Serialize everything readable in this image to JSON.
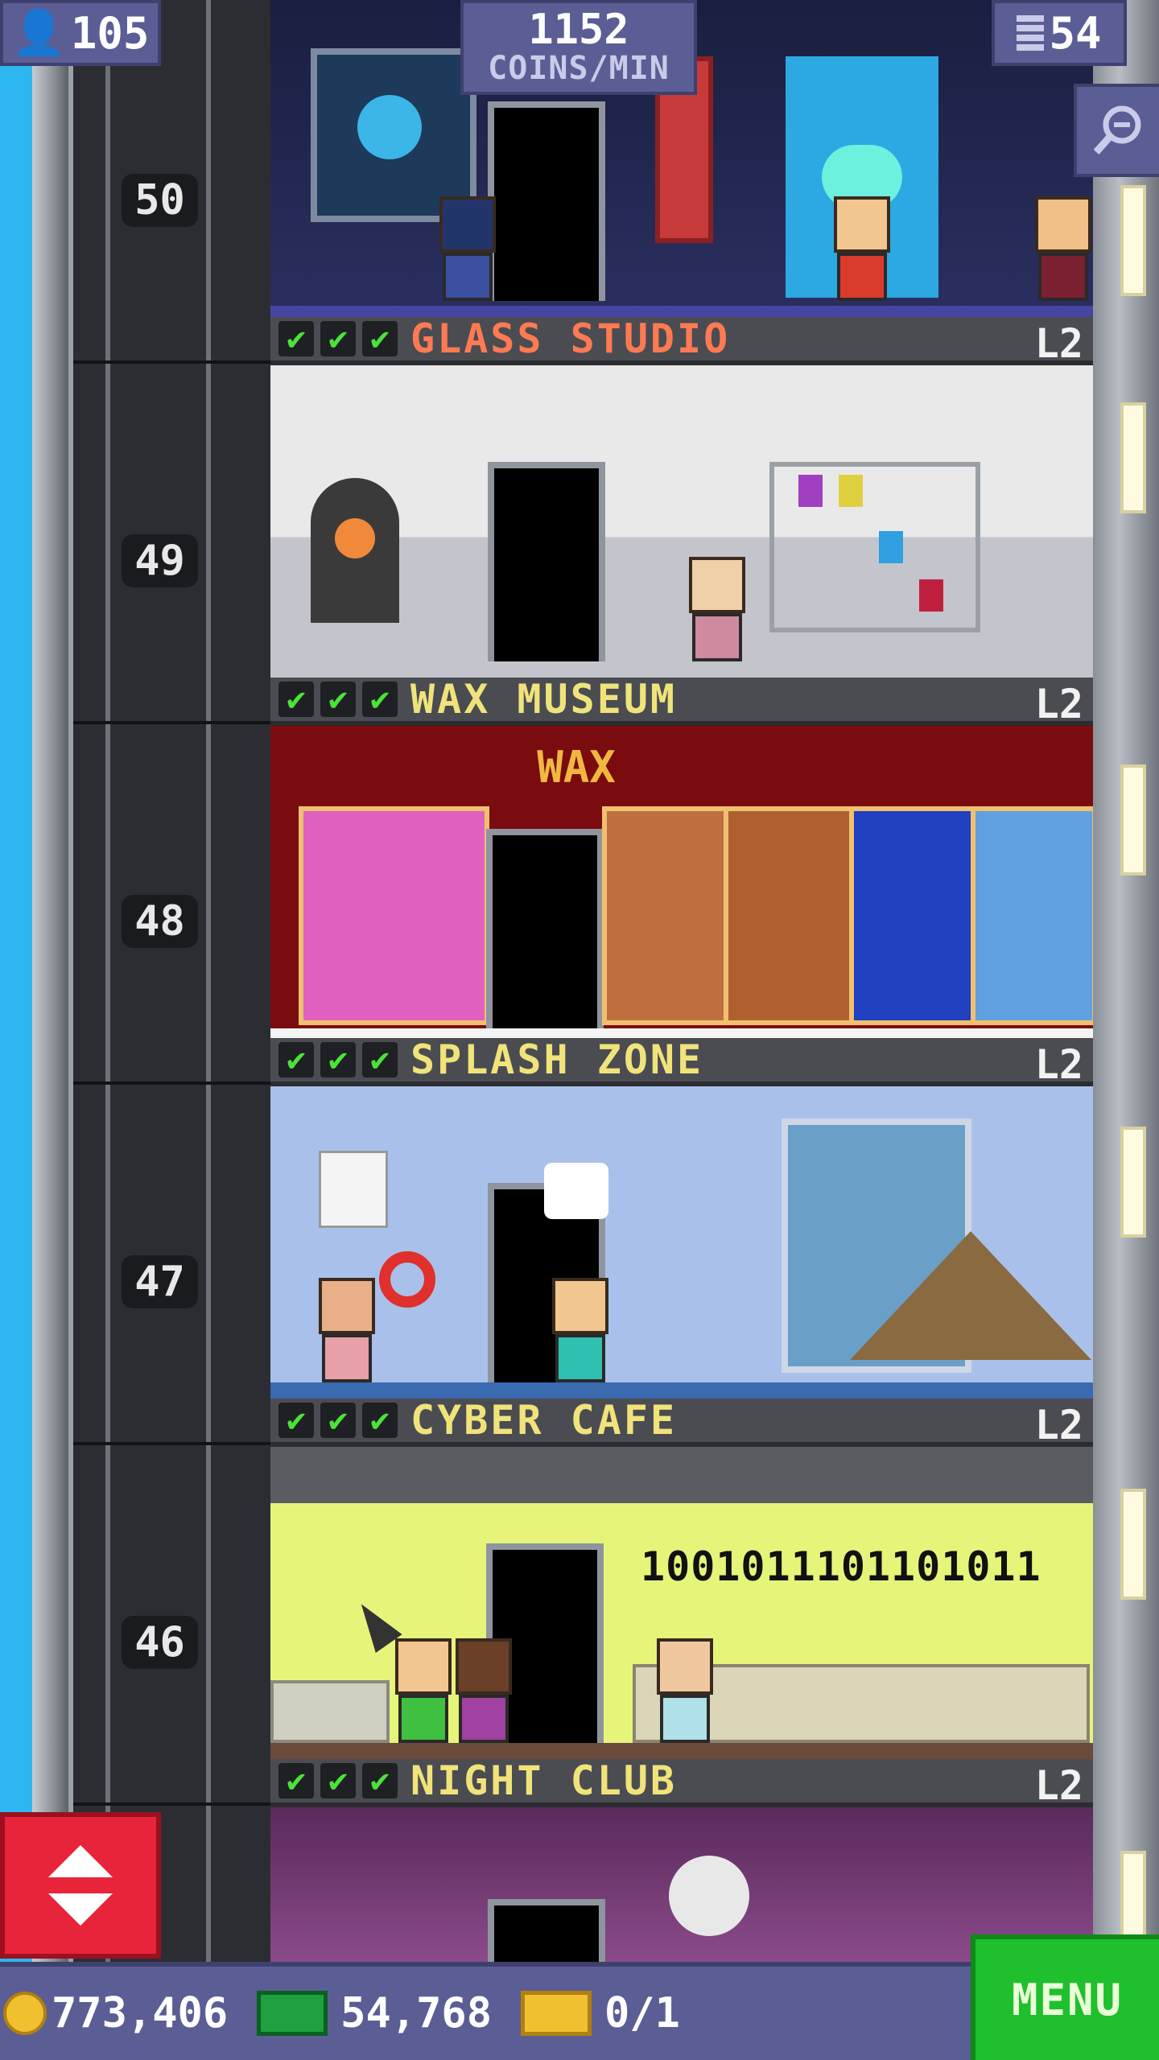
{
  "hud": {
    "population": "105",
    "floors_count": "54",
    "coins_rate": "1152",
    "coins_rate_unit": "COINS/MIN"
  },
  "floors": [
    {
      "number": "50",
      "name": "GLASS STUDIO",
      "level": "L2",
      "checks": 3
    },
    {
      "number": "49",
      "name": "WAX MUSEUM",
      "level": "L2",
      "checks": 3
    },
    {
      "number": "48",
      "name": "SPLASH ZONE",
      "level": "L2",
      "checks": 3
    },
    {
      "number": "47",
      "name": "CYBER CAFE",
      "level": "L2",
      "checks": 3
    },
    {
      "number": "46",
      "name": "NIGHT CLUB",
      "level": "L2",
      "checks": 3
    }
  ],
  "rooms": {
    "wax_sign": "WAX",
    "binary_text": "1001011101101011"
  },
  "bottom": {
    "coins": "773,406",
    "bux": "54,768",
    "tickets": "0/1",
    "menu_label": "MENU"
  },
  "colors": {
    "hud_bg": "#5b5e94",
    "check_green": "#4ce23a",
    "floor_name_yellow": "#f0e37a",
    "menu_green": "#1fbf2e",
    "elevator_button_red": "#e8243a"
  }
}
